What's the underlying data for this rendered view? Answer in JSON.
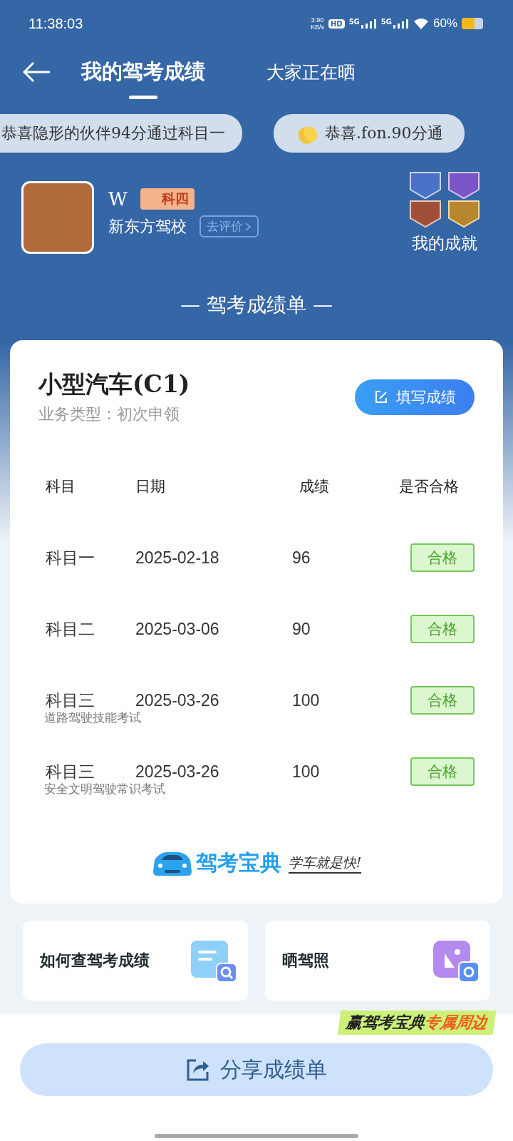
{
  "status_bar": {
    "time": "11:38:03",
    "speed_value": "3.90",
    "speed_unit": "KB/s",
    "hd": "HD",
    "networks": [
      "5G",
      "5G"
    ],
    "battery": "60%"
  },
  "header": {
    "tabs": [
      {
        "label": "我的驾考成绩",
        "selected": true
      },
      {
        "label": "大家正在晒",
        "selected": false
      }
    ]
  },
  "ticker": [
    {
      "kind": "plain",
      "text": "恭喜隐形的伙伴94分通过科目一"
    },
    {
      "kind": "clap",
      "text": "恭喜.fon.90分通"
    }
  ],
  "profile": {
    "name": "W",
    "badge": "科四",
    "school": "新东方驾校",
    "review_button": "去评价",
    "achievements_label": "我的成就"
  },
  "section_title": "— 驾考成绩单 —",
  "card": {
    "vehicle": "小型汽车(C1)",
    "business_type": "业务类型：初次申领",
    "action_button": "填写成绩",
    "columns": [
      "科目",
      "日期",
      "成绩",
      "是否合格"
    ],
    "rows": [
      {
        "subject": "科目一",
        "date": "2025-02-18",
        "score": "96",
        "result": "合格",
        "passed": true
      },
      {
        "subject": "科目二",
        "date": "2025-03-06",
        "score": "90",
        "result": "合格",
        "passed": true
      },
      {
        "subject": "科目三",
        "note": "道路驾驶技能考试",
        "date": "2025-03-26",
        "score": "100",
        "result": "合格",
        "passed": true
      },
      {
        "subject": "科目三",
        "note": "安全文明驾驶常识考试",
        "date": "2025-03-26",
        "score": "100",
        "result": "合格",
        "passed": true
      }
    ],
    "brand": {
      "name": "驾考宝典",
      "slogan": "学车就是快!"
    }
  },
  "shortcuts": [
    {
      "kind": "search",
      "label": "如何查驾考成绩"
    },
    {
      "kind": "photo",
      "label": "晒驾照"
    }
  ],
  "promo": {
    "text": "赢驾考宝典",
    "highlight": "专属周边"
  },
  "share_button": "分享成绩单"
}
